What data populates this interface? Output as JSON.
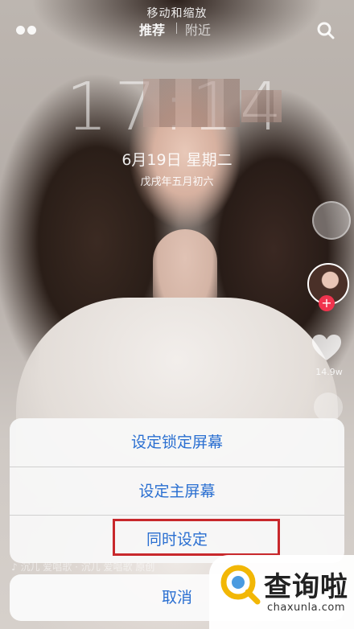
{
  "header": {
    "status_title": "移动和缩放",
    "tabs": [
      {
        "label": "推荐"
      },
      {
        "label": "附近"
      }
    ]
  },
  "lockscreen": {
    "time": "17:14",
    "date": "6月19日 星期二",
    "lunar": "戊戌年五月初六"
  },
  "rail": {
    "like_count": "14.9w"
  },
  "sheet": {
    "options": [
      {
        "label": "设定锁定屏幕"
      },
      {
        "label": "设定主屏幕"
      },
      {
        "label": "同时设定"
      }
    ],
    "cancel_label": "取消"
  },
  "caption": "♪ 沉儿 爱唱歌 · 沉儿 爱唱歌 原创",
  "watermark": {
    "name": "查询啦",
    "url": "chaxunla.com"
  },
  "colors": {
    "option_text": "#2a6fd1",
    "highlight": "#c8282c",
    "follow": "#f0344e",
    "watermark_logo": "#f2b705"
  }
}
